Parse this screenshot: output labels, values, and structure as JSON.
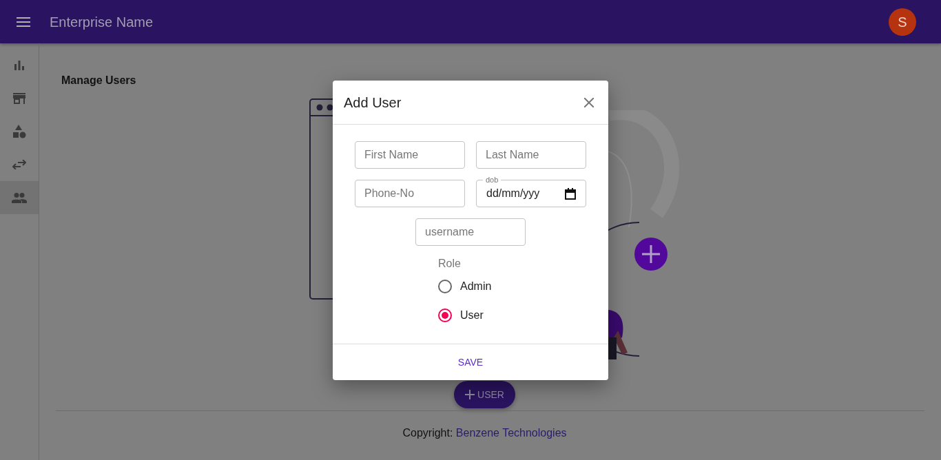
{
  "header": {
    "title": "Enterprise Name",
    "avatar": "S"
  },
  "sidebar": {
    "items": [
      {
        "kind": "chart",
        "selected": false
      },
      {
        "kind": "store",
        "selected": false
      },
      {
        "kind": "shapes",
        "selected": false
      },
      {
        "kind": "swap",
        "selected": false
      },
      {
        "kind": "people",
        "selected": true
      }
    ]
  },
  "page": {
    "title": "Manage Users",
    "add_button": "USER"
  },
  "modal": {
    "title": "Add User",
    "fields": [
      {
        "kind": "text",
        "placeholder": "First Name"
      },
      {
        "kind": "text",
        "placeholder": "Last Name"
      },
      {
        "kind": "text",
        "placeholder": "Phone-No"
      },
      {
        "kind": "date",
        "label": "dob",
        "value": "dd/mm/yyy"
      },
      {
        "kind": "text",
        "placeholder": "username"
      }
    ],
    "role": {
      "label": "Role",
      "options": [
        {
          "label": "Admin",
          "selected": false
        },
        {
          "label": "User",
          "selected": true
        }
      ]
    },
    "save": "SAVE"
  },
  "footer": {
    "prefix": "Copyright:",
    "link": "Benzene Technologies"
  }
}
